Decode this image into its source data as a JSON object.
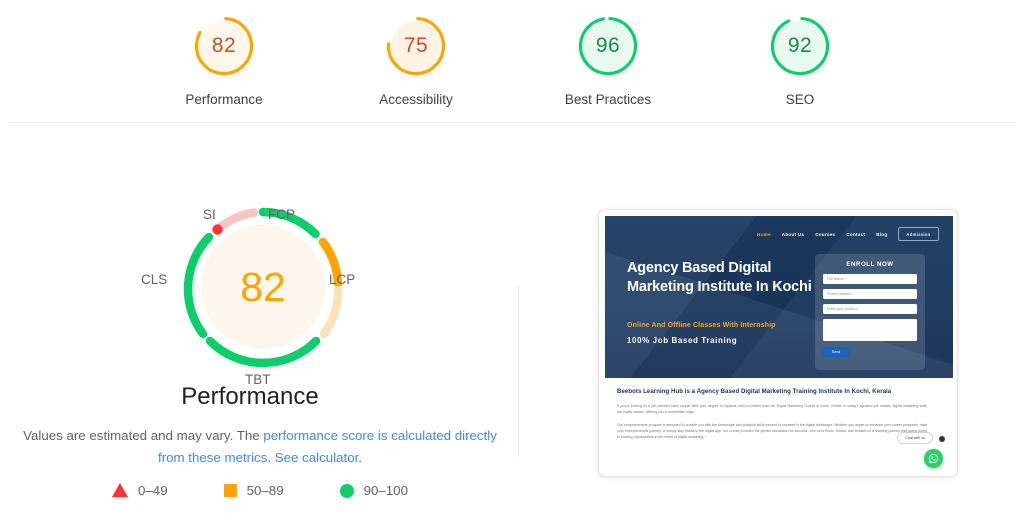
{
  "scores": [
    {
      "value": "82",
      "label": "Performance",
      "color": "#ffa400",
      "fill": "#fff6ec",
      "pct": 82
    },
    {
      "value": "75",
      "label": "Accessibility",
      "color": "#ffa400",
      "fill": "#fff3e3",
      "pct": 75
    },
    {
      "value": "96",
      "label": "Best Practices",
      "color": "#0cce6b",
      "fill": "#e8faef",
      "pct": 96
    },
    {
      "value": "92",
      "label": "SEO",
      "color": "#0cce6b",
      "fill": "#e8faef",
      "pct": 92
    }
  ],
  "performance_gauge": {
    "score": "82",
    "title": "Performance",
    "metrics": [
      {
        "name": "FCP",
        "color": "#0cce6b"
      },
      {
        "name": "LCP",
        "color": "#ffa400"
      },
      {
        "name": "TBT",
        "color": "#0cce6b"
      },
      {
        "name": "CLS",
        "color": "#0cce6b"
      },
      {
        "name": "SI",
        "color": "#f33"
      }
    ]
  },
  "note": {
    "part1": "Values are estimated and may vary. The ",
    "link1": "performance score is calculated directly from these metrics",
    "part2": ". ",
    "link2": "See calculator",
    "part3": "."
  },
  "legend": [
    {
      "marker": "triangle-marker",
      "label": "0–49",
      "color": "#f33"
    },
    {
      "marker": "square-marker",
      "label": "50–89",
      "color": "#ffa400"
    },
    {
      "marker": "circle-marker",
      "label": "90–100",
      "color": "#0cce6b"
    }
  ],
  "screenshot": {
    "nav": [
      {
        "label": "Home",
        "active": true
      },
      {
        "label": "About Us",
        "active": false
      },
      {
        "label": "Courses",
        "active": false
      },
      {
        "label": "Contact",
        "active": false
      },
      {
        "label": "Blog",
        "active": false
      }
    ],
    "nav_button": "Admission",
    "hero_heading": "Agency Based Digital Marketing Institute In Kochi",
    "hero_sub_orange": "Online And Offline Classes With Internship",
    "hero_sub_white": "100% Job Based Training",
    "form": {
      "title": "ENROLL NOW",
      "fields": [
        {
          "placeholder": "Full Name*"
        },
        {
          "placeholder": "Phone number*"
        },
        {
          "placeholder": "Enter your Email id"
        }
      ],
      "send_label": "Send"
    },
    "body_heading": "Beebots Learning Hub is a Agency Based Digital Marketing Training Institute In Kochi, Kerala",
    "body_paragraph_1": "If you're looking for a job-oriented short course after your degree or diploma, look no further than our Digital Marketing Course in Kochi, Kerala. In today's dynamic job market, digital marketing skills are highly valued, offering you a competitive edge.",
    "body_paragraph_2": "Our comprehensive program is designed to provide you with the knowledge and practical skills needed to succeed in the digital landscape. Whether you aspire to enhance your career prospects, start your entrepreneurial journey, or simply stay ahead in the digital age, our course provides the perfect foundation for success. Join us in Kochi, Kerala, and embark on a learning journey that opens doors to exciting opportunities in the realm of digital marketing.",
    "chat_pill": "Chat with us"
  }
}
